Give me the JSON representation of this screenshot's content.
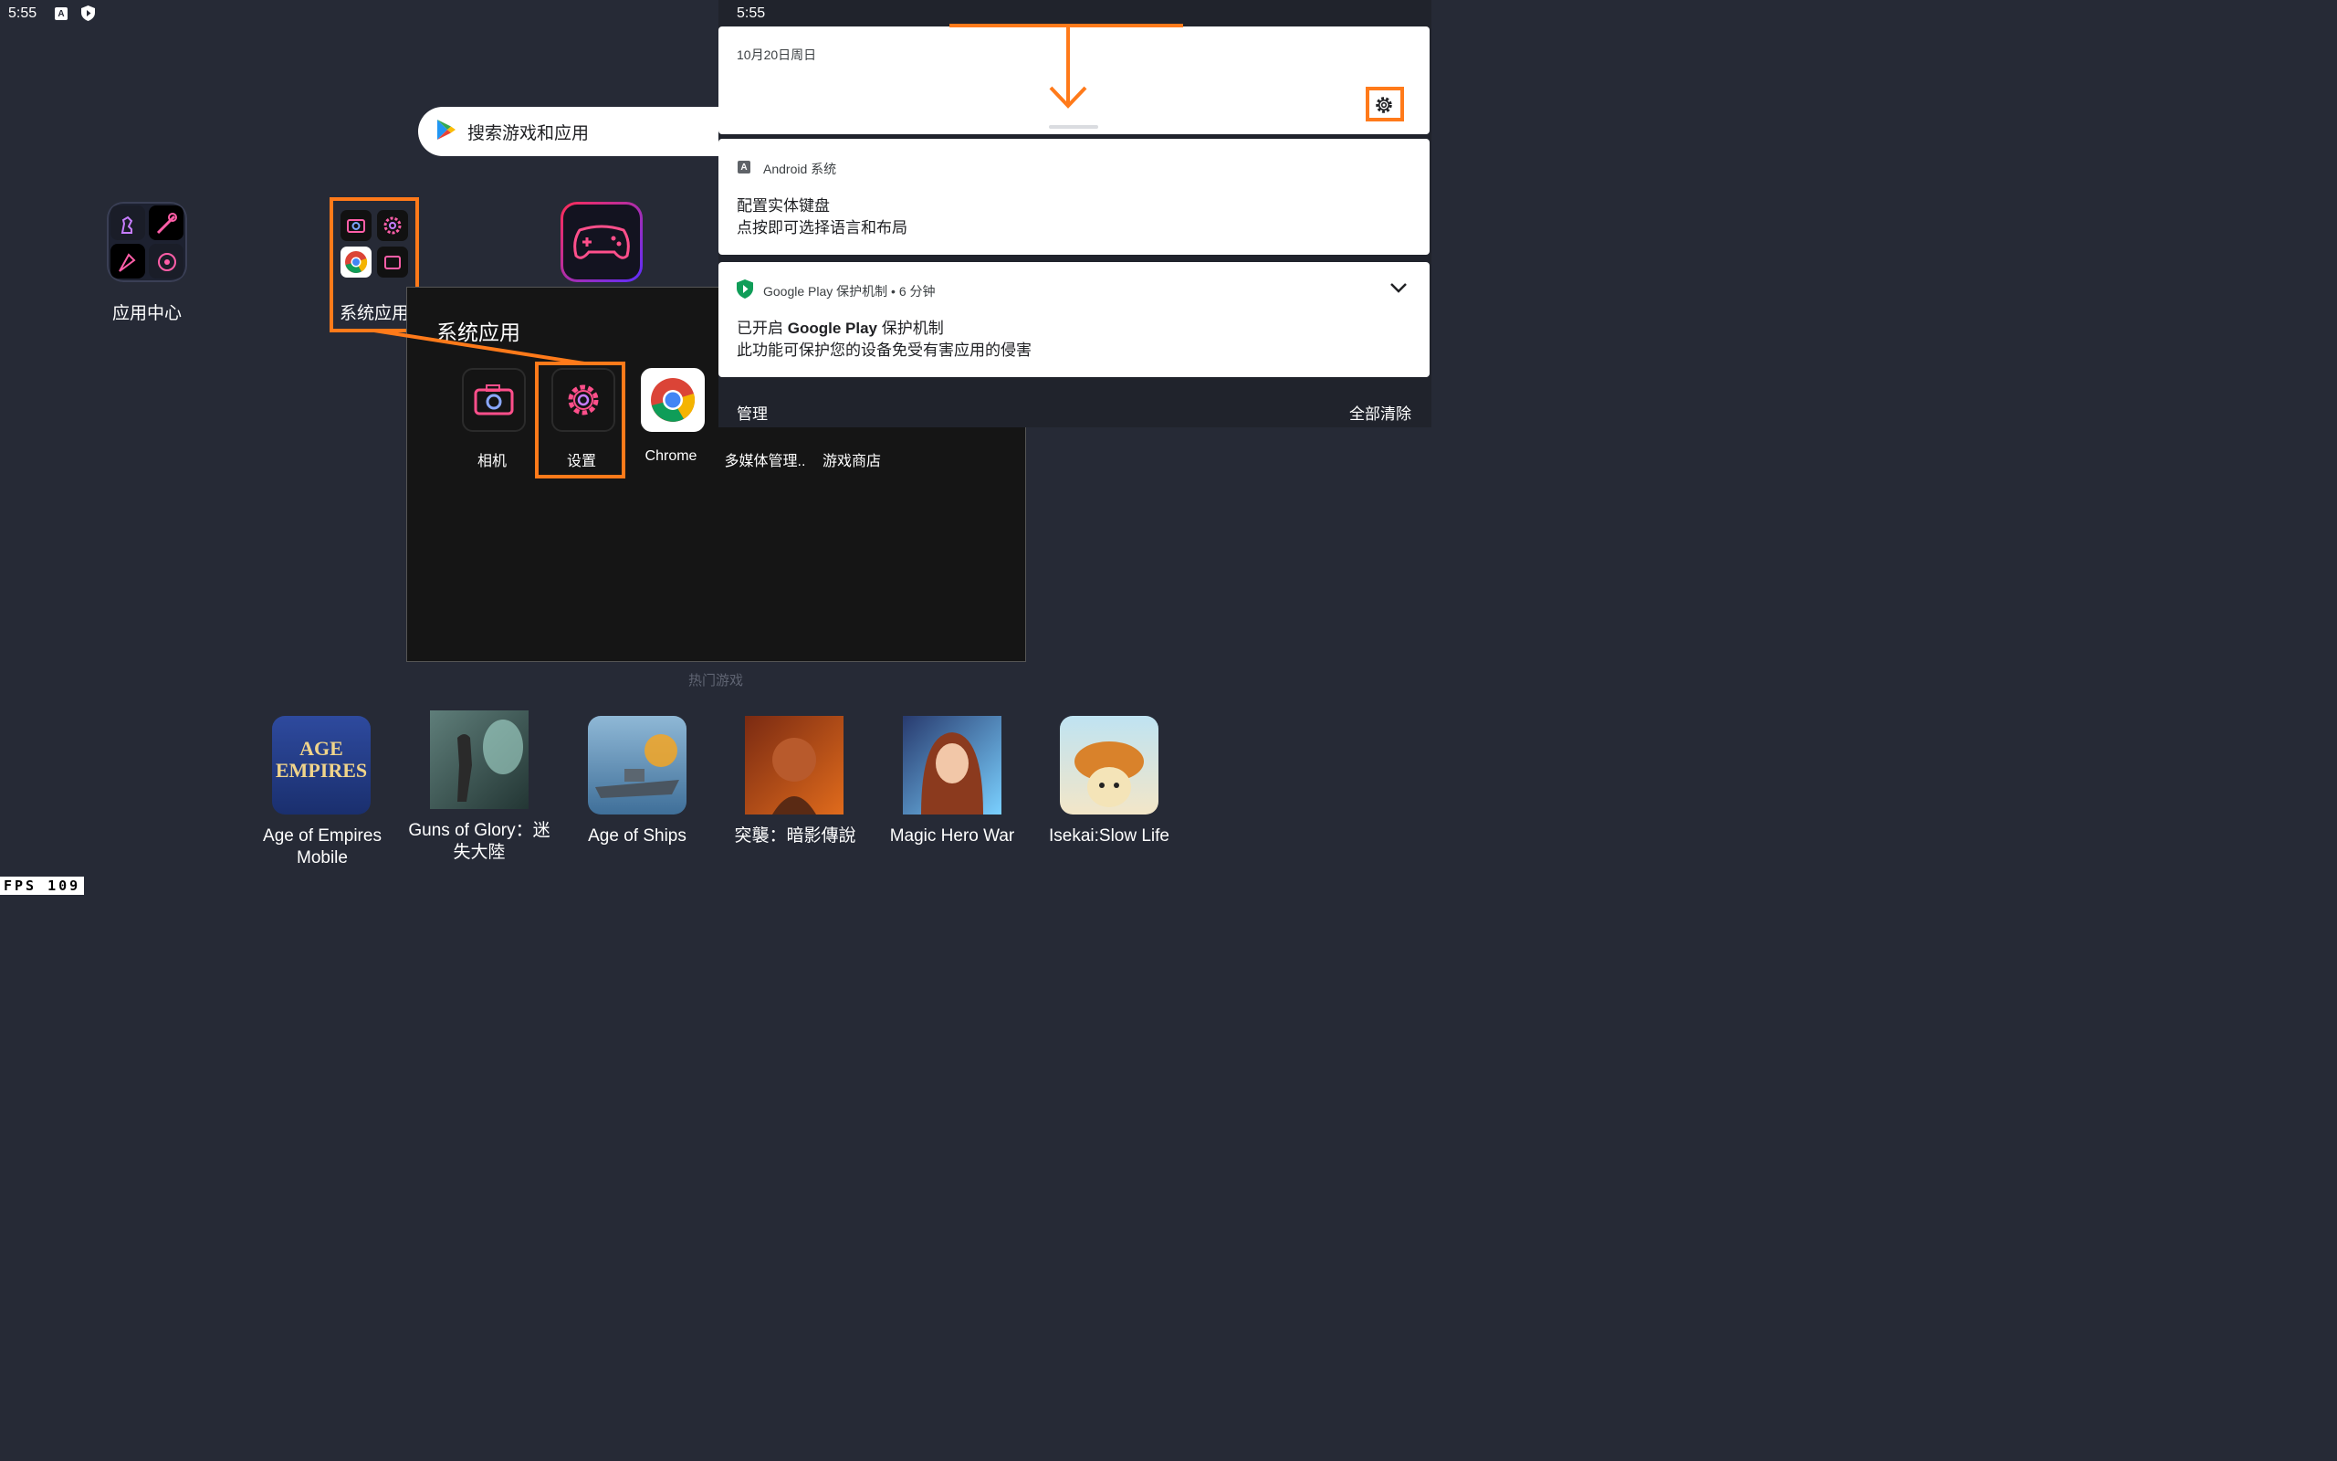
{
  "status_bar": {
    "time_left": "5:55",
    "time_right": "5:55"
  },
  "search": {
    "placeholder": "搜索游戏和应用"
  },
  "launcher": {
    "app_center_label": "应用中心",
    "system_apps_label": "系统应用"
  },
  "folder": {
    "title": "系统应用",
    "apps": [
      {
        "label": "相机",
        "icon": "camera-icon"
      },
      {
        "label": "设置",
        "icon": "settings-gear-icon"
      },
      {
        "label": "Chrome",
        "icon": "chrome-icon"
      },
      {
        "label": "多媒体管理..",
        "icon": "media-manager-icon"
      },
      {
        "label": "游戏商店",
        "icon": "game-store-icon"
      }
    ]
  },
  "shade": {
    "date": "10月20日周日",
    "notifications": [
      {
        "app": "Android 系统",
        "title": "配置实体键盘",
        "text": "点按即可选择语言和布局"
      },
      {
        "app": "Google Play 保护机制 • 6 分钟",
        "title_prefix": "已开启 ",
        "title_bold": "Google Play",
        "title_suffix": " 保护机制",
        "text": "此功能可保护您的设备免受有害应用的侵害"
      }
    ],
    "manage_label": "管理",
    "clear_all_label": "全部清除"
  },
  "hot_games": {
    "heading": "热门游戏",
    "games": [
      {
        "label_line1": "Age of Empires",
        "label_line2": "Mobile",
        "thumb_text": "AGE EMPIRES"
      },
      {
        "label_line1": "Guns of Glory：迷",
        "label_line2": "失大陸"
      },
      {
        "label_line1": "Age of Ships",
        "label_line2": ""
      },
      {
        "label_line1": "突襲：暗影傳說",
        "label_line2": ""
      },
      {
        "label_line1": "Magic Hero War",
        "label_line2": ""
      },
      {
        "label_line1": "Isekai:Slow Life",
        "label_line2": ""
      }
    ]
  },
  "fps": {
    "label": "FPS",
    "value": "109"
  },
  "colors": {
    "highlight": "#ff7a1a",
    "background": "#262a36"
  }
}
